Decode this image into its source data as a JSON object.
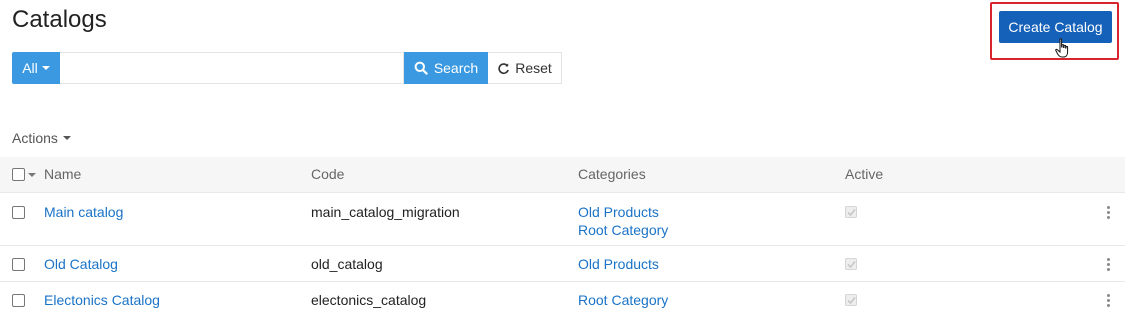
{
  "page": {
    "title": "Catalogs"
  },
  "header": {
    "create_button_label": "Create Catalog"
  },
  "search": {
    "filter_label": "All",
    "placeholder": "",
    "value": "",
    "search_label": "Search",
    "reset_label": "Reset"
  },
  "actions": {
    "label": "Actions"
  },
  "table": {
    "columns": [
      "Name",
      "Code",
      "Categories",
      "Active"
    ],
    "rows": [
      {
        "name": "Main catalog",
        "code": "main_catalog_migration",
        "categories": [
          "Old Products",
          "Root Category"
        ],
        "active": true
      },
      {
        "name": "Old Catalog",
        "code": "old_catalog",
        "categories": [
          "Old Products"
        ],
        "active": true
      },
      {
        "name": "Electonics Catalog",
        "code": "electonics_catalog",
        "categories": [
          "Root Category"
        ],
        "active": true
      }
    ]
  },
  "colors": {
    "primary": "#3a99e0",
    "create_button": "#1560b8",
    "highlight_border": "#d9232d",
    "link": "#1a73c7"
  }
}
